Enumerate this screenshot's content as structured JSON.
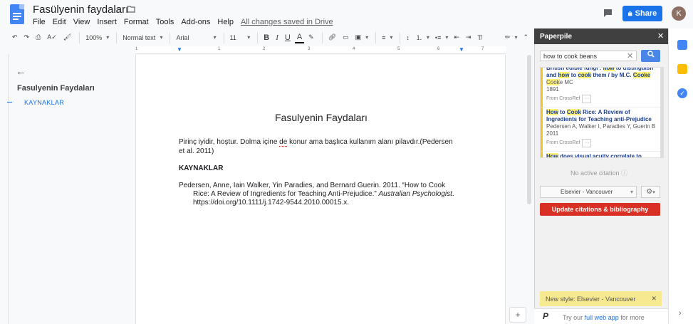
{
  "header": {
    "title": "Fasülyenin faydaları",
    "menu": [
      "File",
      "Edit",
      "View",
      "Insert",
      "Format",
      "Tools",
      "Add-ons",
      "Help"
    ],
    "saved_status": "All changes saved in Drive",
    "share_label": "Share",
    "avatar_initial": "K"
  },
  "toolbar": {
    "zoom": "100%",
    "style": "Normal text",
    "font": "Arial",
    "size": "11"
  },
  "ruler": [
    "1",
    "1",
    "2",
    "3",
    "4",
    "5",
    "6",
    "7"
  ],
  "outline": {
    "title": "Fasulyenin Faydaları",
    "items": [
      "KAYNAKLAR"
    ]
  },
  "document": {
    "heading": "Fasulyenin Faydaları",
    "paragraph_before": "Pirinç iyidir, hoştur. Dolma içine ",
    "paragraph_misspelled": "de",
    "paragraph_after": " konur ama başlıca kullanım alanı pilavdır.(Pedersen et al. 2011)",
    "references_heading": "KAYNAKLAR",
    "reference_text": "Pedersen, Anne, Iain Walker, Yin Paradies, and Bernard Guerin. 2011. “How to Cook Rice: A Review of Ingredients for Teaching Anti-Prejudice.” ",
    "reference_journal": "Australian Psychologist",
    "reference_tail": ". https://doi.org/10.1111/j.1742-9544.2010.00015.x."
  },
  "paperpile": {
    "title": "Paperpile",
    "search_value": "how to cook beans",
    "results": [
      {
        "title_html": "British edible fungi : <em>how</em> to distinguish and <em>how</em> to <em>cook</em> them / by M.C. <em>Cooke</em>",
        "authors_html": "<em>Cook</em>e MC",
        "year": "1891",
        "source": "From CrossRef"
      },
      {
        "title_html": "<em>How</em> to <em>Cook</em> Rice: A Review of Ingredients for Teaching anti-Prejudice",
        "authors_html": "Pedersen A, Walker I, Paradies Y, Guerin B",
        "year": "2011",
        "source": "From CrossRef"
      },
      {
        "title_html": "<em>How</em> does visual acuity correlate to recognizing a tin of <em>beans</em>?",
        "authors_html": "",
        "year": "",
        "source": ""
      }
    ],
    "no_citation": "No active citation",
    "citation_style": "Elsevier - Vancouver",
    "update_button": "Update citations & bibliography",
    "notice": "New style: Elsevier - Vancouver",
    "footer_before": "Try our ",
    "footer_link": "full web app",
    "footer_after": " for more"
  },
  "colors": {
    "share": "#1a73e8",
    "update": "#d93025",
    "paperpile_header": "#404040",
    "notice": "#f7e98f"
  }
}
